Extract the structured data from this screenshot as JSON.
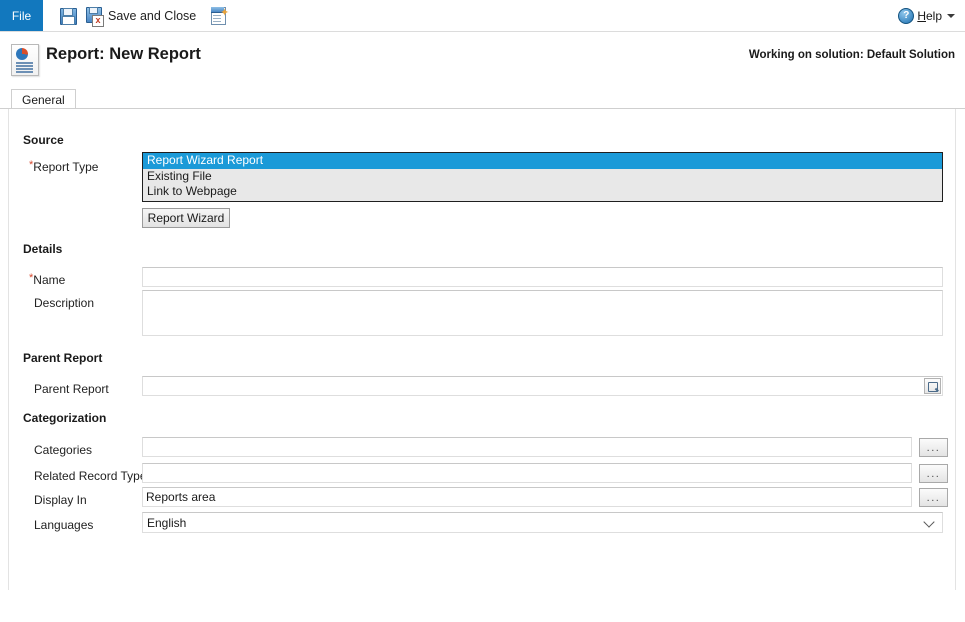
{
  "commandbar": {
    "file_tab": "File",
    "buttons": [
      {
        "label": "",
        "icon": "save-icon",
        "name": "save-button"
      },
      {
        "label": "Save and Close",
        "icon": "save-and-close-icon",
        "name": "save-and-close-button"
      },
      {
        "label": "",
        "icon": "new-report-icon",
        "name": "new-button"
      }
    ],
    "help": {
      "icon": "help-icon",
      "label_before": "H",
      "label_after": "elp"
    }
  },
  "record_header": {
    "icon": "report-icon",
    "title": "Report: New Report",
    "solution_text": "Working on solution: Default Solution"
  },
  "tabs": [
    {
      "label": "General",
      "selected": true
    }
  ],
  "form": {
    "sections": {
      "source": {
        "title": "Source",
        "report_type": {
          "label": "Report Type",
          "required": true,
          "options": [
            "Report Wizard Report",
            "Existing File",
            "Link to Webpage"
          ],
          "selected": "Report Wizard Report"
        },
        "report_wizard_button": "Report Wizard"
      },
      "details": {
        "title": "Details",
        "name": {
          "label": "Name",
          "required": true,
          "value": "",
          "placeholder": ""
        },
        "description": {
          "label": "Description",
          "required": false,
          "value": "",
          "placeholder": ""
        }
      },
      "parent_report": {
        "title": "Parent Report",
        "parent_report": {
          "label": "Parent Report",
          "value": "",
          "placeholder": "",
          "lookup_icon": "lookup-icon"
        }
      },
      "categorization": {
        "title": "Categorization",
        "categories": {
          "label": "Categories",
          "value": "",
          "placeholder": "",
          "button": "..."
        },
        "related_record_types": {
          "label": "Related Record Types",
          "value": "",
          "placeholder": "",
          "button": "..."
        },
        "display_in": {
          "label": "Display In",
          "value": "Reports area",
          "placeholder": "",
          "button": "..."
        },
        "languages": {
          "label": "Languages",
          "value": "English",
          "options": [
            "English"
          ]
        }
      }
    }
  },
  "colors": {
    "accent_blue": "#1278be",
    "selection_blue": "#1b9ad8",
    "required_red": "#d6492f",
    "border_gray": "#dedede"
  }
}
